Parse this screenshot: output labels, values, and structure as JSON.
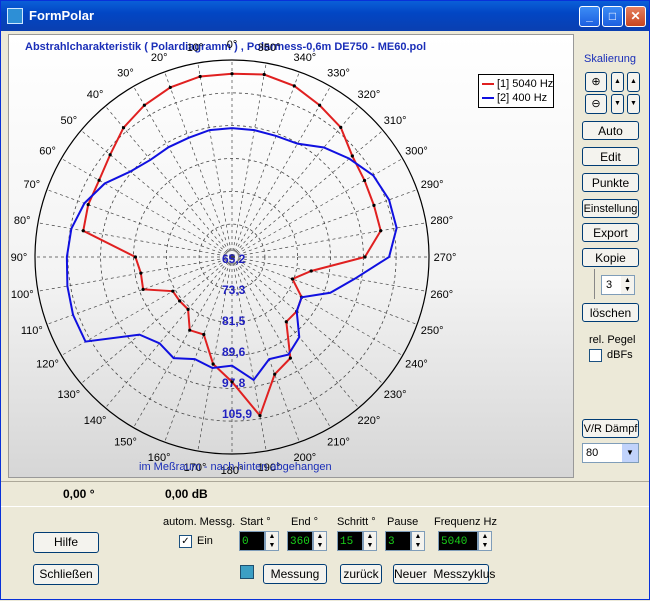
{
  "window": {
    "title": "FormPolar"
  },
  "plot": {
    "title": "Abstrahlcharakteristik ( Polardiagramm ) , Polarmess-0,6m DE750 - ME60.pol",
    "subtitle": "im Meßraum - nach hinten abgehangen",
    "angle_labels": [
      "0°",
      "10°",
      "20°",
      "30°",
      "40°",
      "50°",
      "60°",
      "70°",
      "80°",
      "90°",
      "100°",
      "110°",
      "120°",
      "130°",
      "140°",
      "150°",
      "160°",
      "170°",
      "180°",
      "190°",
      "200°",
      "210°",
      "220°",
      "230°",
      "240°",
      "250°",
      "260°",
      "270°",
      "280°",
      "290°",
      "300°",
      "310°",
      "320°",
      "330°",
      "340°",
      "350°"
    ],
    "ring_labels": [
      "65,2",
      "73,3",
      "81,5",
      "89,6",
      "97,8",
      "105,9"
    ],
    "legend": [
      {
        "label": "[1] 5040 Hz",
        "color": "#e02020"
      },
      {
        "label": "[2] 400 Hz",
        "color": "#1010e0"
      }
    ]
  },
  "chart_data": {
    "type": "polar",
    "radial_labels": [
      "65,2",
      "73,3",
      "81,5",
      "89,6",
      "97,8",
      "105,9"
    ],
    "series": [
      {
        "name": "[1] 5040 Hz",
        "color": "#e02020",
        "angles": [
          0,
          10,
          20,
          30,
          40,
          50,
          60,
          70,
          80,
          90,
          100,
          110,
          120,
          130,
          140,
          150,
          160,
          170,
          180,
          190,
          200,
          210,
          220,
          230,
          240,
          250,
          260,
          270,
          280,
          290,
          300,
          310,
          320,
          330,
          340,
          350
        ],
        "values": [
          102.5,
          102.5,
          101.8,
          100.5,
          98.9,
          96.5,
          95.1,
          95,
          94.5,
          81,
          80,
          80.5,
          74,
          74,
          74,
          78,
          77.5,
          84,
          88,
          97,
          88,
          86,
          78,
          78,
          77,
          73,
          77,
          90,
          94.5,
          94.5,
          95,
          96,
          99,
          100.5,
          102.2,
          103
        ]
      },
      {
        "name": "[2] 400 Hz",
        "color": "#1010e0",
        "angles": [
          0,
          10,
          20,
          30,
          40,
          50,
          60,
          70,
          80,
          90,
          100,
          110,
          120,
          130,
          140,
          150,
          160,
          170,
          180,
          190,
          200,
          210,
          220,
          230,
          240,
          250,
          260,
          270,
          280,
          290,
          300,
          310,
          320,
          330,
          340,
          350
        ],
        "values": [
          89,
          89,
          88.5,
          88.5,
          88.5,
          90,
          93.5,
          96,
          97.5,
          98,
          98.5,
          99,
          99,
          87,
          85,
          86,
          84,
          85,
          84,
          88,
          84,
          85,
          83,
          78,
          77,
          83,
          88,
          96,
          98.5,
          98.5,
          97.5,
          95,
          92.5,
          89.5,
          89,
          89
        ]
      }
    ]
  },
  "panel": {
    "scale_label": "Skalierung",
    "btn_auto": "Auto",
    "btn_edit": "Edit",
    "btn_punkte": "Punkte",
    "btn_einstellung": "Einstellung",
    "btn_export": "Export",
    "btn_kopie": "Kopie",
    "kopie_value": "3",
    "btn_loeschen": "löschen",
    "rel_pegel": "rel. Pegel",
    "dbfs": "dBFs",
    "btn_vr": "V/R Dämpf",
    "vr_value": "80"
  },
  "status": {
    "angle": "0,00 °",
    "level": "0,00 dB"
  },
  "controls": {
    "btn_hilfe": "Hilfe",
    "btn_schliessen": "Schließen",
    "autom_label": "autom. Messg.",
    "ein": "Ein",
    "start_label": "Start °",
    "start_val": "0",
    "end_label": "End °",
    "end_val": "360",
    "schritt_label": "Schritt °",
    "schritt_val": "15",
    "pause_label": "Pause",
    "pause_val": "3",
    "freq_label": "Frequenz Hz",
    "freq_val": "5040",
    "btn_messung": "Messung",
    "btn_zurueck": "zurück",
    "btn_neuer": "Neuer  Messzyklus"
  }
}
